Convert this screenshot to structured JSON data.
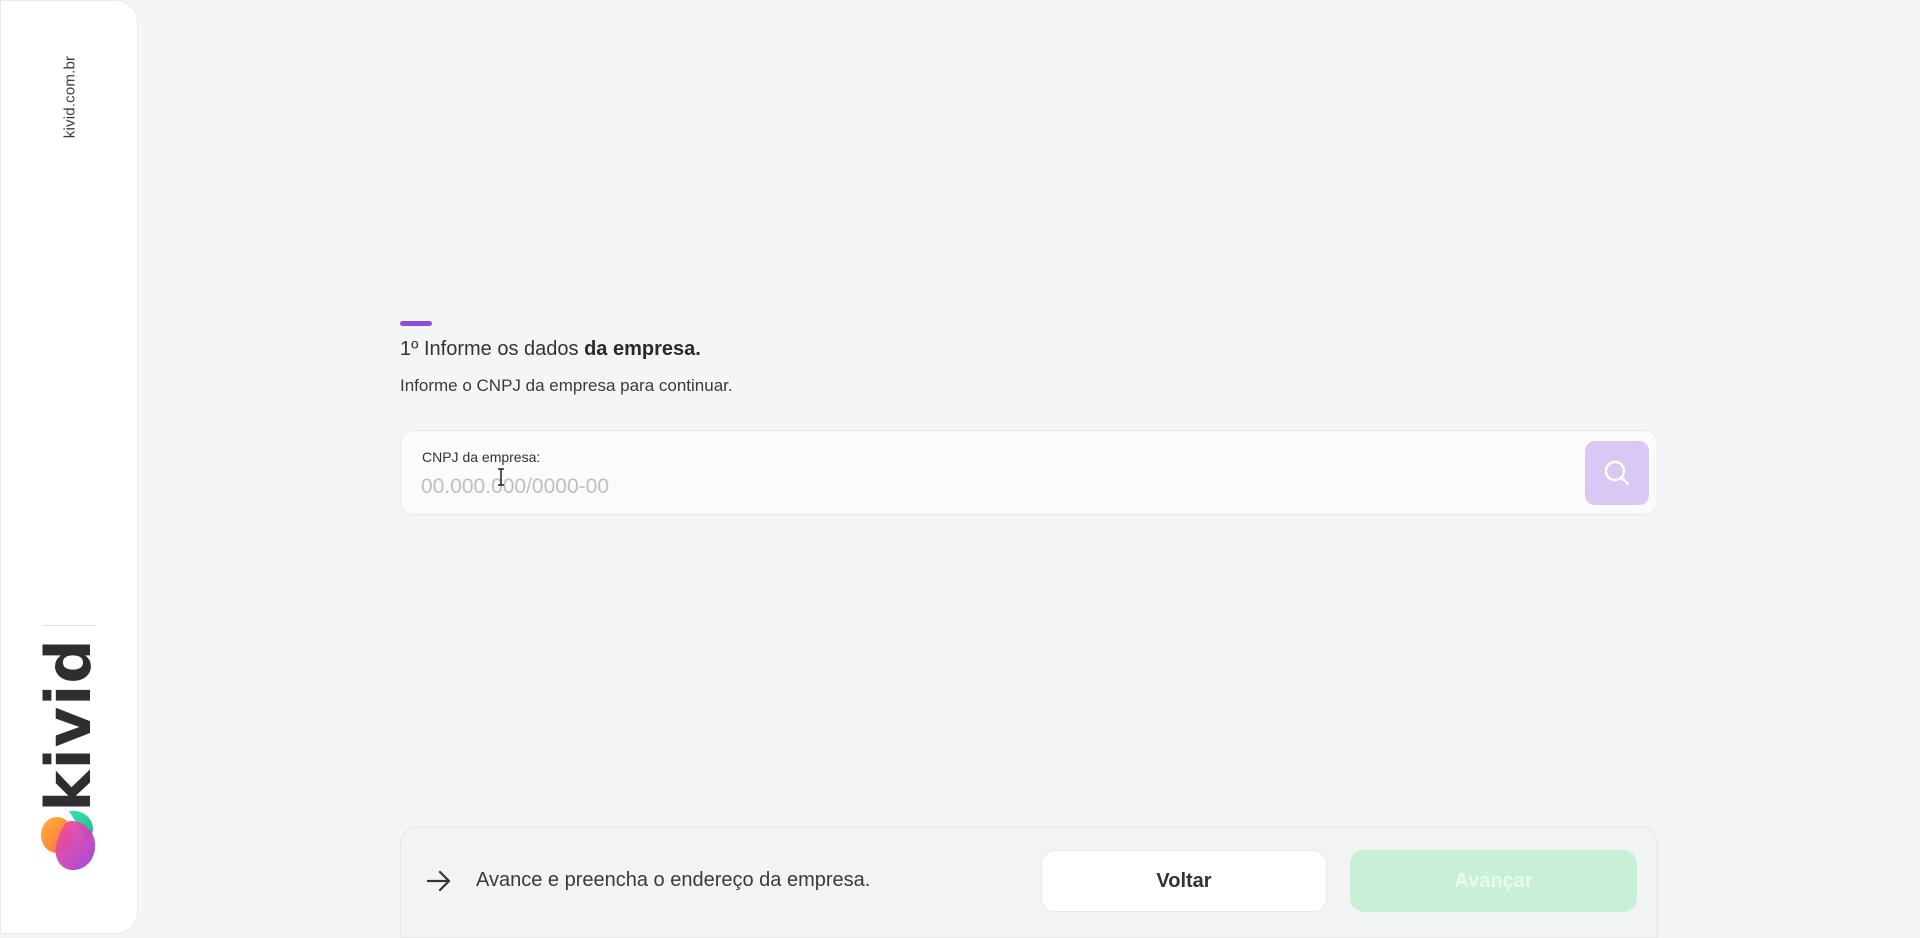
{
  "sidebar": {
    "site_url": "kivid.com.br",
    "brand_name": "kivid"
  },
  "step": {
    "title_prefix": "1º Informe os dados ",
    "title_bold": "da empresa.",
    "subtitle": "Informe o CNPJ da empresa para continuar."
  },
  "cnpj_field": {
    "label": "CNPJ da empresa:",
    "placeholder": "00.000.000/0000-00",
    "value": ""
  },
  "footer": {
    "next_hint": "Avance e preencha o endereço da empresa.",
    "back_label": "Voltar",
    "next_label": "Avançar"
  },
  "colors": {
    "accent": "#8a4fd6",
    "search_button": "#d8c8f3",
    "next_button_disabled": "#c8f0d6"
  },
  "icons": {
    "search": "search-icon",
    "arrow": "arrow-right-icon",
    "logo": "kivid-logo-icon"
  }
}
